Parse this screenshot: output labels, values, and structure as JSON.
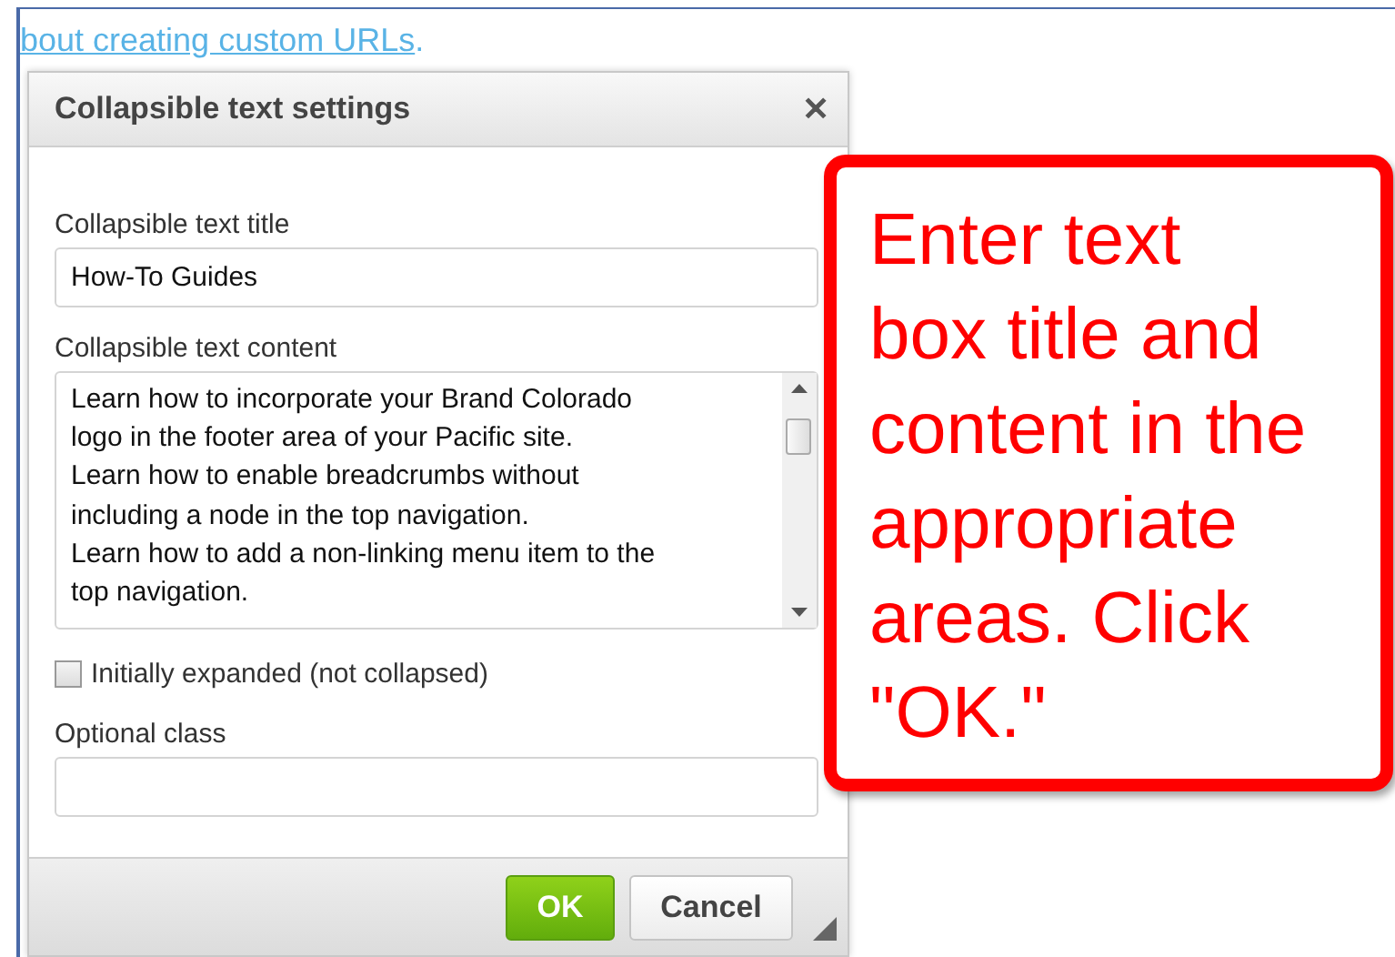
{
  "page": {
    "link": "bout creating custom URLs",
    "link_suffix": "."
  },
  "dialog": {
    "title": "Collapsible text settings",
    "close": "✕",
    "fields": [
      {
        "kind": "text",
        "label": "Collapsible text title",
        "value": "How-To Guides"
      },
      {
        "kind": "textarea",
        "label": "Collapsible text content",
        "value": "Learn how to incorporate your Brand Colorado\nlogo in the footer area of your Pacific site.\nLearn how to enable breadcrumbs without\nincluding a node in the top navigation.\nLearn how to add a non-linking menu item to the\ntop navigation."
      },
      {
        "kind": "checkbox",
        "label": "Initially expanded (not collapsed)",
        "checked": false
      },
      {
        "kind": "text",
        "label": "Optional class"
      }
    ],
    "buttons": [
      {
        "label": "OK",
        "kind": "primary"
      },
      {
        "label": "Cancel",
        "kind": "secondary"
      }
    ]
  },
  "callout": {
    "text": "Enter text\nbox title and\ncontent in the\nappropriate\nareas. Click\n\"OK.\""
  }
}
